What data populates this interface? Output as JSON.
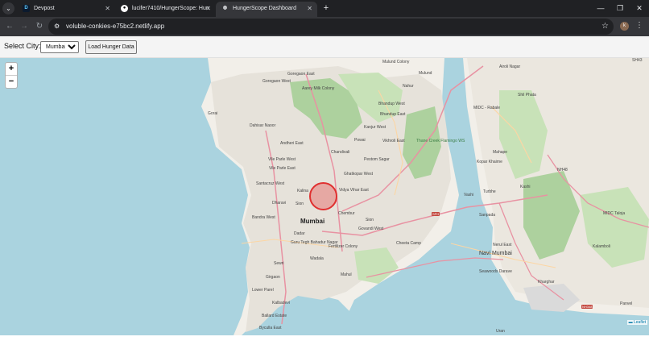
{
  "browser": {
    "tabs": [
      {
        "title": "Devpost",
        "favicon": "D"
      },
      {
        "title": "lucifer7410/HungerScope: Hun",
        "favicon": "github-icon"
      },
      {
        "title": "HungerScope Dashboard",
        "favicon": "globe-icon"
      }
    ],
    "url": "voluble-conkies-e75bc2.netlify.app",
    "profile_initial": "k"
  },
  "controls": {
    "city_label": "Select City:",
    "city_selected": "Mumbai",
    "load_button": "Load Hunger Data"
  },
  "map": {
    "zoom_in": "+",
    "zoom_out": "−",
    "attribution": "Leaflet",
    "labels": {
      "mumbai": "Mumbai",
      "navi_mumbai": "Navi Mumbai",
      "goregaon": "Goregaon East",
      "goregaon_west": "Goregaon West",
      "aarey": "Aarey Milk Colony",
      "mulund_colony": "Mulund Colony",
      "mulund": "Mulund",
      "nahur": "Nahur",
      "bhandup_west": "Bhandup West",
      "bhandup_east": "Bhandup East",
      "kanjur": "Kanjur West",
      "airoli": "Airoli Nagar",
      "midc_rabale": "MIDC - Rabale",
      "shil_phata": "Shil Phata",
      "gorai": "Gorai",
      "dahisar": "Dahisar Naoor",
      "andheri": "Andheri East",
      "chandivali": "Chandivali",
      "powai": "Powai",
      "vikhroli": "Vikhroli East",
      "thane_creek": "Thane Creek Flamingo WS",
      "mahape": "Mahape",
      "vile_parle_west": "Vile Parle West",
      "vile_parle": "Vile Parle East",
      "ghatkopar_west": "Ghatkopar West",
      "pestom": "Pestom Sagar",
      "kopar": "Kopar Khairne",
      "santacruz": "Santacruz West",
      "kalina": "Kalina",
      "vidya": "Vidya Vihar East",
      "turbhe": "Turbhe",
      "vashi": "Vashi",
      "bandra": "Bandra West",
      "dharavi": "Dharavi",
      "sion": "Sion",
      "chembur": "Chembur",
      "sanpada": "Sanpada",
      "midc_taloja": "MIDC Taloja",
      "dadar": "Dadar",
      "sewri": "Sewri",
      "fertilizer": "Fertilizer Colony",
      "govandi": "Govandi West",
      "cheeta": "Cheeta Camp",
      "gtb": "Guru Tegh Bahadur Nagar",
      "wadala": "Wadala",
      "nerul": "Nerul East",
      "kalamboli": "Kalamboli",
      "girgaon": "Girgaon",
      "lower_parel": "Lower Parel",
      "mahul": "Mahul",
      "seawoods": "Seawoods Darave",
      "kharghar": "Kharghar",
      "kalbadevi": "Kalbadevi",
      "ballard": "Ballard Estate",
      "panvel": "Panvel",
      "byculla": "Byculla East",
      "uran": "Uran",
      "nh348": "NH348",
      "nh48": "NH48",
      "sh_north": "SH43",
      "nh_east": "SH",
      "sph": "SPH",
      "nh4b": "NH4B",
      "kashi": "Kashi"
    }
  },
  "colors": {
    "land": "#f2efe9",
    "water": "#aad3df",
    "urban": "#e0dcd5",
    "forest": "#add19e",
    "road_major": "#e892a2",
    "road_primary": "#fcd6a4",
    "circle": "#e03030"
  }
}
